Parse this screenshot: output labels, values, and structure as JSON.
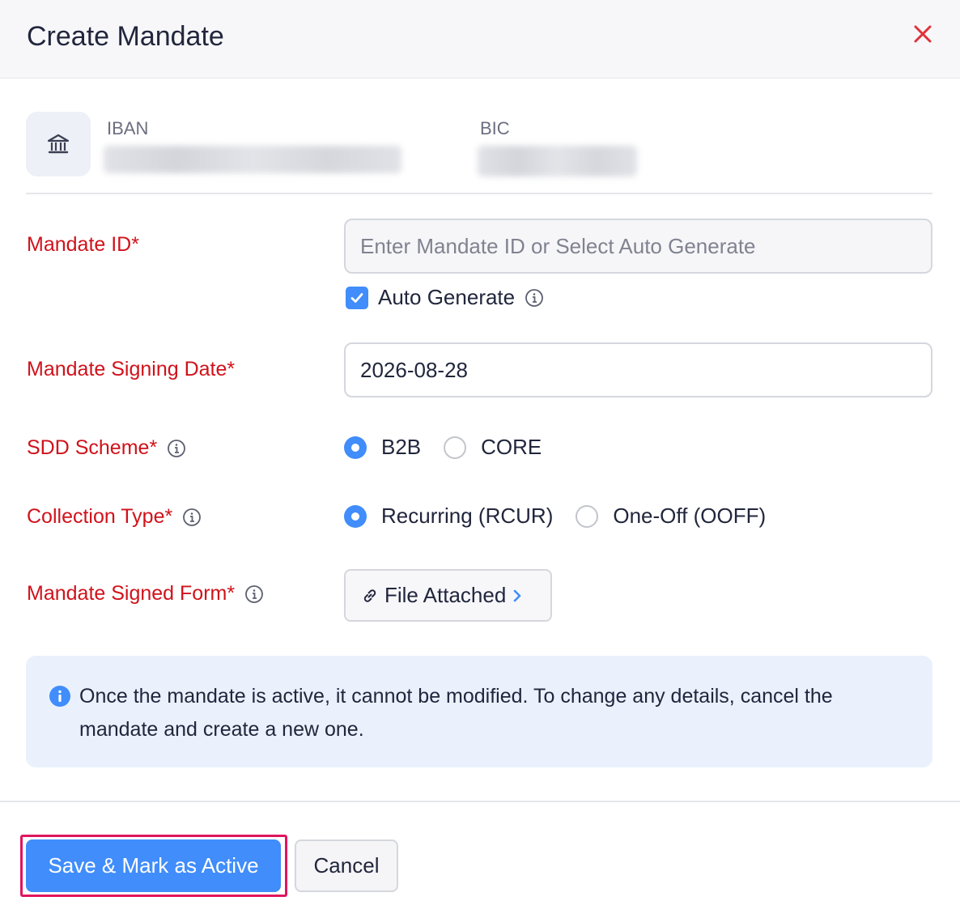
{
  "dialog": {
    "title": "Create Mandate"
  },
  "account": {
    "iban_label": "IBAN",
    "bic_label": "BIC"
  },
  "form": {
    "mandate_id": {
      "label": "Mandate ID*",
      "placeholder": "Enter Mandate ID or Select Auto Generate",
      "value": "",
      "auto_generate_label": "Auto Generate",
      "auto_generate_checked": true
    },
    "signing_date": {
      "label": "Mandate Signing Date*",
      "value": "2026-08-28"
    },
    "sdd_scheme": {
      "label": "SDD Scheme*",
      "options": [
        "B2B",
        "CORE"
      ],
      "selected": "B2B"
    },
    "collection_type": {
      "label": "Collection Type*",
      "options": [
        "Recurring (RCUR)",
        "One-Off (OOFF)"
      ],
      "selected": "Recurring (RCUR)"
    },
    "signed_form": {
      "label": "Mandate Signed Form*",
      "button_label": "File Attached"
    }
  },
  "notice": {
    "text": "Once the mandate is active, it cannot be modified. To change any details, cancel the mandate and create a new one."
  },
  "footer": {
    "primary_label": "Save & Mark as Active",
    "secondary_label": "Cancel"
  },
  "colors": {
    "accent": "#408dfb",
    "required_label": "#d0121b",
    "close_icon": "#e0323a",
    "highlight_border": "#e0155e",
    "notice_bg": "#eaf1fd"
  },
  "icons": {
    "close": "close-icon",
    "bank": "bank-icon",
    "info": "info-icon",
    "checkmark": "checkmark-icon",
    "link": "link-icon",
    "chevron": "chevron-right-icon"
  }
}
